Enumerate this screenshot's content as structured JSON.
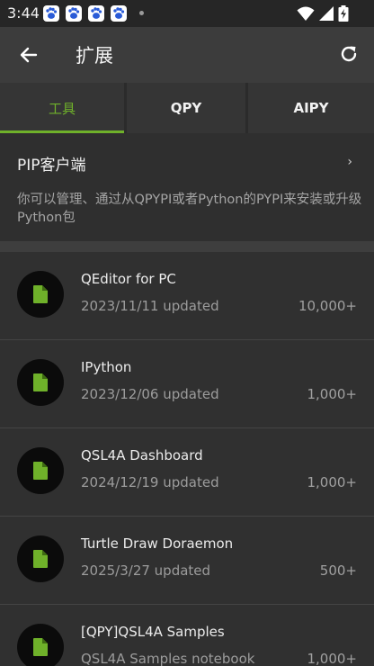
{
  "status": {
    "time": "3:44"
  },
  "appbar": {
    "title": "扩展"
  },
  "tabs": [
    {
      "label": "工具",
      "active": true
    },
    {
      "label": "QPY",
      "active": false
    },
    {
      "label": "AIPY",
      "active": false
    }
  ],
  "pip": {
    "title": "PIP客户端",
    "chevron": "›",
    "description": "你可以管理、通过从QPYPI或者Python的PYPI来安装或升级Python包"
  },
  "items": [
    {
      "title": "QEditor for PC",
      "subtitle": "2023/11/11 updated",
      "count": "10,000+"
    },
    {
      "title": "IPython",
      "subtitle": "2023/12/06 updated",
      "count": "1,000+"
    },
    {
      "title": "QSL4A Dashboard",
      "subtitle": "2024/12/19 updated",
      "count": "1,000+"
    },
    {
      "title": "Turtle Draw Doraemon",
      "subtitle": "2025/3/27 updated",
      "count": "500+"
    },
    {
      "title": "[QPY]QSL4A Samples",
      "subtitle": "QSL4A Samples notebook",
      "count": "1,000+"
    }
  ],
  "colors": {
    "accent": "#6fb12a",
    "background": "#303030",
    "appbar": "#3c3c3c"
  },
  "icons": {
    "back": "arrow-left-icon",
    "refresh": "refresh-icon",
    "item": "file-icon",
    "notification": "baidu-paw-icon"
  }
}
